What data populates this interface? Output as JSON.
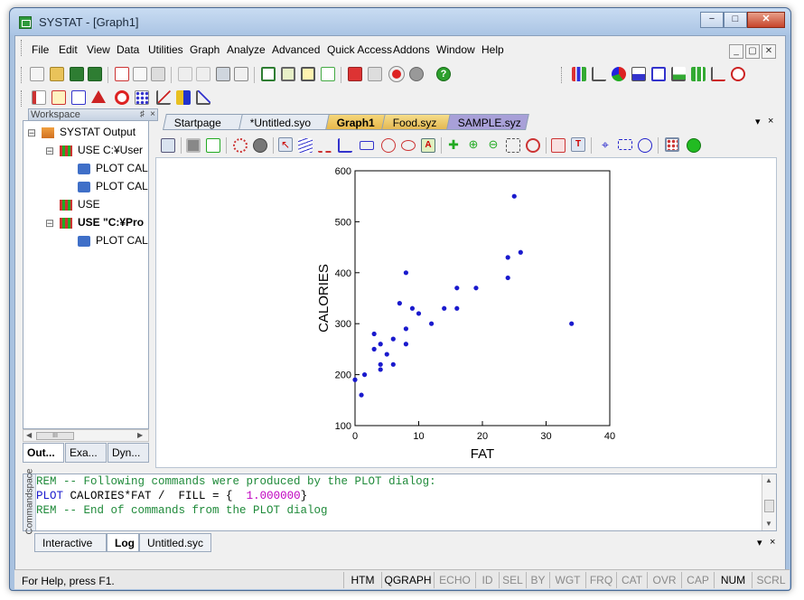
{
  "window": {
    "title": "SYSTAT - [Graph1]",
    "minimize": "0",
    "maximize": "1",
    "close": "r"
  },
  "menu": {
    "items": [
      "File",
      "Edit",
      "View",
      "Data",
      "Utilities",
      "Graph",
      "Analyze",
      "Advanced",
      "Quick Access",
      "Addons",
      "Window",
      "Help"
    ],
    "mdi_controls": [
      "_",
      "▢",
      "✕"
    ]
  },
  "toolbar_icons": {
    "row1_left": [
      "new-icon",
      "open-icon",
      "save-icon",
      "save-all-icon",
      "cut-icon",
      "copy-icon",
      "paste-icon",
      "undo-icon",
      "redo-icon",
      "print-icon",
      "print-preview-icon",
      "workspace-icon",
      "output-icon",
      "graph-view-icon",
      "editor-icon",
      "data-editor-icon",
      "variable-icon",
      "record-icon",
      "stop-icon",
      "help-icon"
    ],
    "row1_right": [
      "bar-chart-icon",
      "line-chart-icon",
      "pie-chart-icon",
      "histogram-icon",
      "box-plot-icon",
      "density-icon",
      "function-plot-icon",
      "map-icon"
    ],
    "row2": [
      "ruler-icon",
      "scale-icon",
      "equation-icon",
      "triangle-icon",
      "target-icon",
      "dot-grid-icon",
      "line-fit-icon",
      "color-bars-icon",
      "stat-chart-icon"
    ]
  },
  "workspace": {
    "header": "Workspace",
    "pin": "♯",
    "close": "×",
    "tree": [
      {
        "label": "SYSTAT Output",
        "level": 0,
        "bold": false
      },
      {
        "label": "USE C:¥User",
        "level": 1,
        "bold": false
      },
      {
        "label": "PLOT CAL",
        "level": 2,
        "bold": false
      },
      {
        "label": "PLOT CAL",
        "level": 2,
        "bold": false
      },
      {
        "label": "USE",
        "level": 1,
        "bold": false
      },
      {
        "label": "USE \"C:¥Pro",
        "level": 1,
        "bold": true
      },
      {
        "label": "PLOT CAL",
        "level": 2,
        "bold": false
      }
    ],
    "scroll_thumb_glyph": "III",
    "tabs": [
      "Out...",
      "Exa...",
      "Dyn..."
    ]
  },
  "doc_tabs": [
    "Startpage",
    "*Untitled.syo",
    "Graph1",
    "Food.syz",
    "SAMPLE.syz"
  ],
  "doc_tab_controls": [
    "▾",
    "×"
  ],
  "chart_data": {
    "type": "scatter",
    "title": "",
    "xlabel": "FAT",
    "ylabel": "CALORIES",
    "xlim": [
      0,
      40
    ],
    "ylim": [
      100,
      600
    ],
    "xticks": [
      "0",
      "10",
      "20",
      "30",
      "40"
    ],
    "yticks": [
      "100",
      "200",
      "300",
      "400",
      "500",
      "600"
    ],
    "grid": false,
    "point_color": "#1a1acd",
    "points": [
      [
        0,
        190
      ],
      [
        1,
        160
      ],
      [
        1.5,
        200
      ],
      [
        3,
        280
      ],
      [
        3,
        250
      ],
      [
        4,
        260
      ],
      [
        4,
        220
      ],
      [
        4,
        210
      ],
      [
        5,
        240
      ],
      [
        6,
        270
      ],
      [
        6,
        220
      ],
      [
        7,
        340
      ],
      [
        8,
        400
      ],
      [
        8,
        290
      ],
      [
        8,
        260
      ],
      [
        9,
        330
      ],
      [
        10,
        320
      ],
      [
        12,
        300
      ],
      [
        14,
        330
      ],
      [
        16,
        370
      ],
      [
        16,
        330
      ],
      [
        19,
        370
      ],
      [
        24,
        430
      ],
      [
        24,
        390
      ],
      [
        25,
        550
      ],
      [
        26,
        440
      ],
      [
        34,
        300
      ]
    ]
  },
  "commands": {
    "side_label": "Commandspace",
    "lines": [
      {
        "parts": [
          {
            "text": "REM -- Following commands were produced by the PLOT dialog:",
            "color": "#1f8a3a"
          }
        ]
      },
      {
        "parts": [
          {
            "text": "PLOT ",
            "color": "#1a1acd"
          },
          {
            "text": "CALORIES*FAT /  FILL = {  ",
            "color": "#000000"
          },
          {
            "text": "1.000000",
            "color": "#c000c0"
          },
          {
            "text": "}",
            "color": "#000000"
          }
        ]
      },
      {
        "parts": [
          {
            "text": "REM -- End of commands from the PLOT dialog",
            "color": "#1f8a3a"
          }
        ]
      }
    ],
    "tabs": [
      "Interactive",
      "Log",
      "Untitled.syc"
    ],
    "controls": [
      "▾",
      "×"
    ]
  },
  "status": {
    "help_text": "For Help, press F1.",
    "indicators": [
      {
        "label": "HTM",
        "active": true
      },
      {
        "label": "QGRAPH",
        "active": true
      },
      {
        "label": "ECHO",
        "active": false
      },
      {
        "label": "ID",
        "active": false
      },
      {
        "label": "SEL",
        "active": false
      },
      {
        "label": "BY",
        "active": false
      },
      {
        "label": "WGT",
        "active": false
      },
      {
        "label": "FRQ",
        "active": false
      },
      {
        "label": "CAT",
        "active": false
      },
      {
        "label": "OVR",
        "active": false
      },
      {
        "label": "CAP",
        "active": false
      },
      {
        "label": "NUM",
        "active": true
      },
      {
        "label": "SCRL",
        "active": false
      }
    ]
  }
}
